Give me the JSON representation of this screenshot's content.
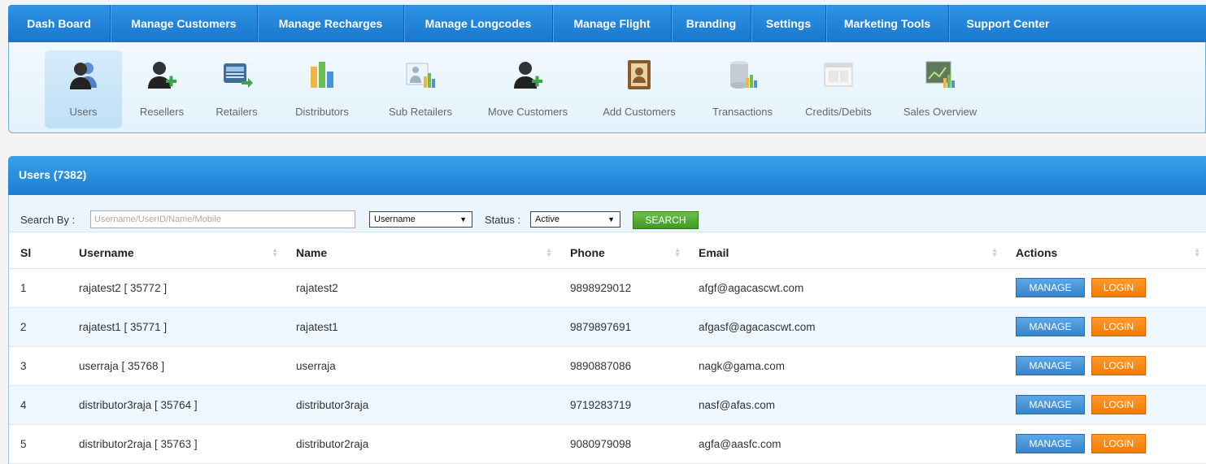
{
  "nav": [
    "Dash Board",
    "Manage Customers",
    "Manage Recharges",
    "Manage Longcodes",
    "Manage Flight",
    "Branding",
    "Settings",
    "Marketing Tools",
    "Support Center"
  ],
  "toolbar": [
    {
      "label": "Users",
      "icon": "users-icon"
    },
    {
      "label": "Resellers",
      "icon": "resellers-icon"
    },
    {
      "label": "Retailers",
      "icon": "retailers-icon"
    },
    {
      "label": "Distributors",
      "icon": "distributors-icon"
    },
    {
      "label": "Sub Retailers",
      "icon": "sub-retailers-icon"
    },
    {
      "label": "Move Customers",
      "icon": "move-customers-icon"
    },
    {
      "label": "Add Customers",
      "icon": "address-book-icon"
    },
    {
      "label": "Transactions",
      "icon": "database-chart-icon"
    },
    {
      "label": "Credits/Debits",
      "icon": "window-icon"
    },
    {
      "label": "Sales Overview",
      "icon": "sales-chart-icon"
    }
  ],
  "panel": {
    "title": "Users (7382)"
  },
  "search": {
    "label": "Search By :",
    "placeholder": "Username/UserID/Name/Mobile",
    "field_selected": "Username",
    "status_label": "Status :",
    "status_selected": "Active",
    "button": "SEARCH"
  },
  "table": {
    "headers": [
      "Sl",
      "Username",
      "Name",
      "Phone",
      "Email",
      "Actions"
    ],
    "rows": [
      {
        "sl": "1",
        "username": "rajatest2 [ 35772 ]",
        "name": "rajatest2",
        "phone": "9898929012",
        "email": "afgf@agacascwt.com"
      },
      {
        "sl": "2",
        "username": "rajatest1 [ 35771 ]",
        "name": "rajatest1",
        "phone": "9879897691",
        "email": "afgasf@agacascwt.com"
      },
      {
        "sl": "3",
        "username": "userraja [ 35768 ]",
        "name": "userraja",
        "phone": "9890887086",
        "email": "nagk@gama.com"
      },
      {
        "sl": "4",
        "username": "distributor3raja [ 35764 ]",
        "name": "distributor3raja",
        "phone": "9719283719",
        "email": "nasf@afas.com"
      },
      {
        "sl": "5",
        "username": "distributor2raja [ 35763 ]",
        "name": "distributor2raja",
        "phone": "9080979098",
        "email": "agfa@aasfc.com"
      }
    ],
    "manage_label": "MANAGE",
    "login_label": "LOGIN"
  }
}
